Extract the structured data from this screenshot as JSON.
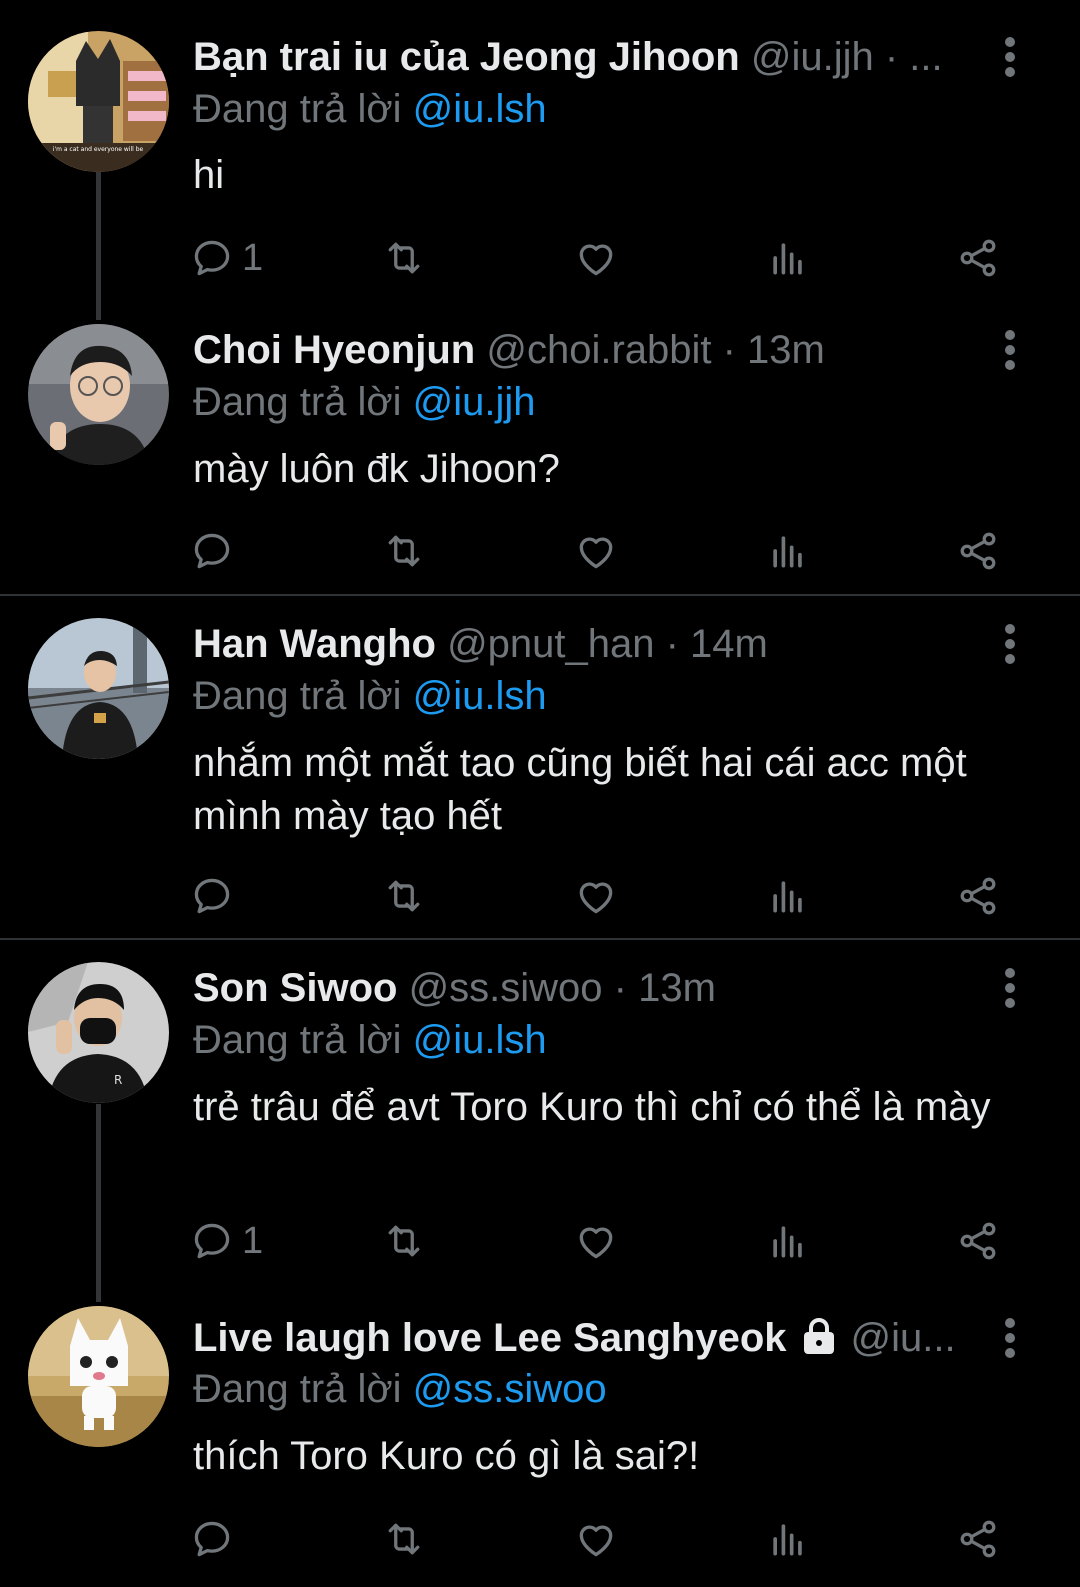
{
  "reply_prefix": "Đang trả lời",
  "tweets": [
    {
      "name": "Bạn trai iu của Jeong Jihoon",
      "meta": "@iu.jjh · ...",
      "reply_to": "@iu.lsh",
      "text": "hi",
      "reply_count": "1",
      "avatar": "toro-kuro-black-cat-avatar"
    },
    {
      "name": "Choi Hyeonjun",
      "meta": "@choi.rabbit · 13m",
      "reply_to": "@iu.jjh",
      "text": "mày luôn đk Jihoon?",
      "reply_count": "",
      "avatar": "person-glasses-avatar"
    },
    {
      "name": "Han Wangho",
      "meta": "@pnut_han · 14m",
      "reply_to": "@iu.lsh",
      "text": "nhắm một mắt tao cũng biết hai cái acc một mình mày tạo hết",
      "reply_count": "",
      "avatar": "person-bridge-avatar"
    },
    {
      "name": "Son Siwoo",
      "meta": "@ss.siwoo · 13m",
      "reply_to": "@iu.lsh",
      "text": "trẻ trâu để avt Toro Kuro thì chỉ có thể là mày",
      "reply_count": "1",
      "avatar": "person-mask-avatar"
    },
    {
      "name": "Live laugh love Lee Sanghyeok",
      "meta": "@iu...",
      "reply_to": "@ss.siwoo",
      "text": "thích Toro Kuro có gì là sai?!",
      "reply_count": "",
      "avatar": "toro-white-cat-avatar",
      "locked": true
    }
  ],
  "icons": {
    "reply": "reply-icon",
    "retweet": "retweet-icon",
    "like": "heart-icon",
    "views": "views-icon",
    "share": "share-icon",
    "more": "more-vertical-icon",
    "lock": "lock-icon"
  },
  "colors": {
    "background": "#000000",
    "text": "#e7e9ea",
    "muted": "#71767b",
    "mention": "#1d9bf0",
    "divider": "#2f3336"
  }
}
